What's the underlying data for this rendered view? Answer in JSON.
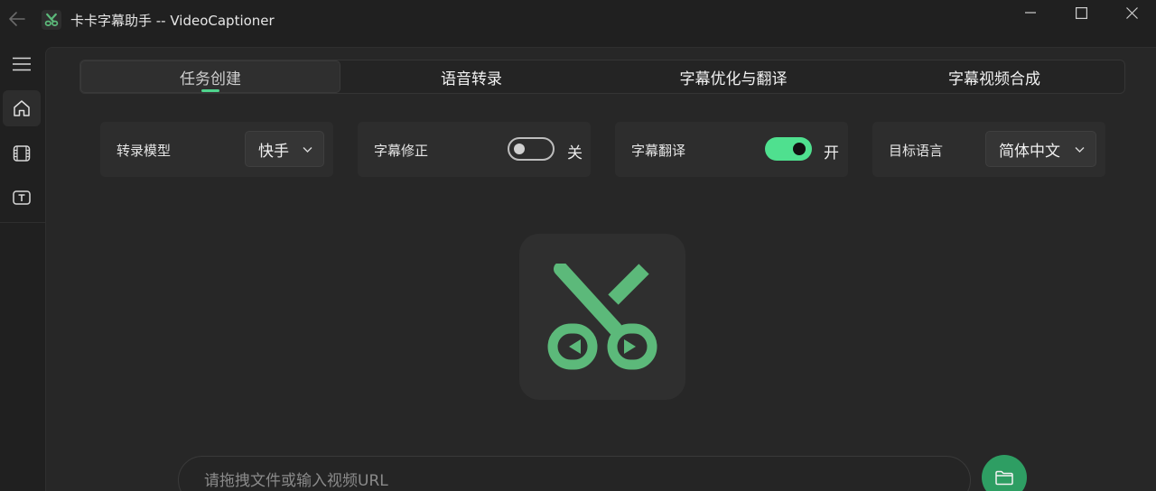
{
  "window": {
    "title": "卡卡字幕助手 -- VideoCaptioner",
    "controls": {
      "minimize_icon": "minimize-icon",
      "maximize_icon": "maximize-icon",
      "close_icon": "close-icon"
    }
  },
  "sidebar": {
    "items": [
      {
        "name": "menu",
        "icon": "hamburger-icon"
      },
      {
        "name": "home",
        "icon": "home-icon",
        "selected": true
      },
      {
        "name": "video",
        "icon": "film-icon"
      },
      {
        "name": "text",
        "icon": "text-box-icon"
      }
    ]
  },
  "tabs": [
    {
      "label": "任务创建",
      "active": true
    },
    {
      "label": "语音转录",
      "active": false
    },
    {
      "label": "字幕优化与翻译",
      "active": false
    },
    {
      "label": "字幕视频合成",
      "active": false
    }
  ],
  "options": {
    "transcribe_model": {
      "label": "转录模型",
      "value": "快手"
    },
    "subtitle_fix": {
      "label": "字幕修正",
      "state_text": "关",
      "on": false
    },
    "subtitle_translate": {
      "label": "字幕翻译",
      "state_text": "开",
      "on": true
    },
    "target_language": {
      "label": "目标语言",
      "value": "简体中文"
    }
  },
  "input": {
    "placeholder": "请拖拽文件或输入视频URL"
  },
  "colors": {
    "accent": "#4fe08f",
    "logo_green": "#5cb97a",
    "background": "#272727",
    "folder_button": "#2e9e63"
  }
}
